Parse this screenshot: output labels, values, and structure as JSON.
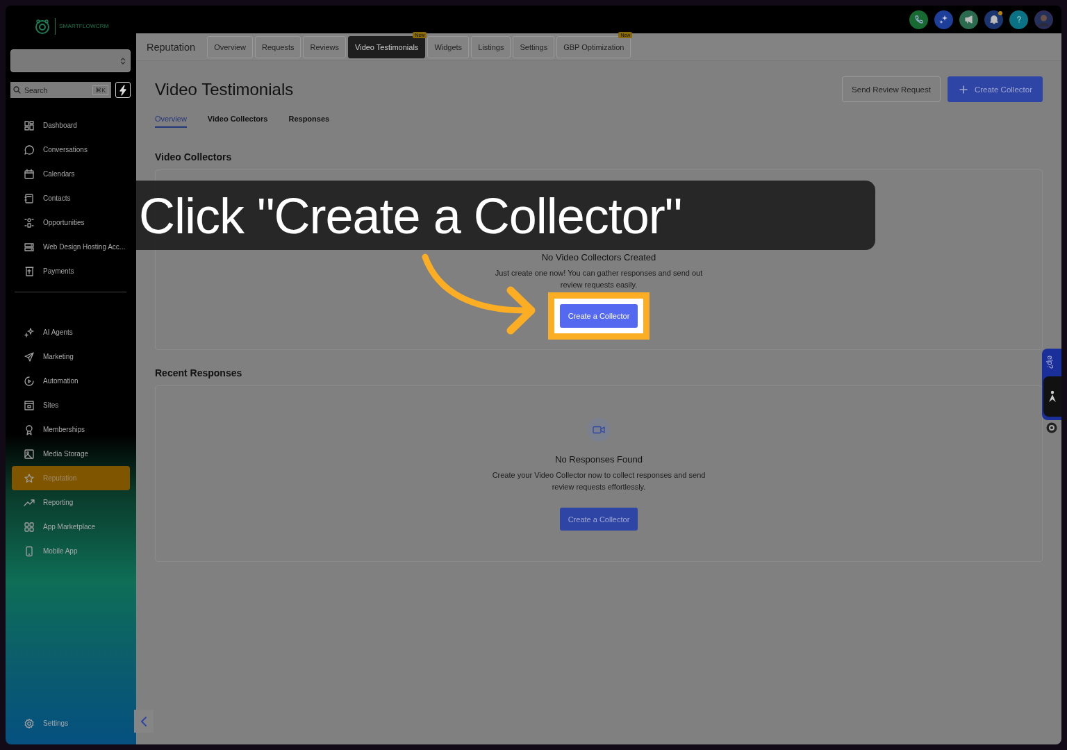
{
  "sidebar": {
    "logo": "SMARTFLOWCRM",
    "search": {
      "placeholder": "Search",
      "shortcut": "⌘K"
    },
    "groups": [
      [
        {
          "label": "Dashboard",
          "selected": false
        },
        {
          "label": "Conversations",
          "selected": false
        },
        {
          "label": "Calendars",
          "selected": false
        },
        {
          "label": "Contacts",
          "selected": false
        },
        {
          "label": "Opportunities",
          "selected": false
        },
        {
          "label": "Web Design Hosting Acc...",
          "selected": false
        },
        {
          "label": "Payments",
          "selected": false
        }
      ],
      [
        {
          "label": "AI Agents",
          "selected": false
        },
        {
          "label": "Marketing",
          "selected": false
        },
        {
          "label": "Automation",
          "selected": false
        },
        {
          "label": "Sites",
          "selected": false
        },
        {
          "label": "Memberships",
          "selected": false
        },
        {
          "label": "Media Storage",
          "selected": false
        },
        {
          "label": "Reputation",
          "selected": true
        },
        {
          "label": "Reporting",
          "selected": false
        },
        {
          "label": "App Marketplace",
          "selected": false
        },
        {
          "label": "Mobile App",
          "selected": false
        }
      ]
    ],
    "settings": "Settings"
  },
  "top_bar": {
    "notification_dot": true
  },
  "header": {
    "section": "Reputation",
    "tabs": [
      {
        "label": "Overview",
        "selected": false
      },
      {
        "label": "Requests",
        "selected": false
      },
      {
        "label": "Reviews",
        "selected": false
      },
      {
        "label": "Video Testimonials",
        "selected": true,
        "badge": "New"
      },
      {
        "label": "Widgets",
        "selected": false
      },
      {
        "label": "Listings",
        "selected": false
      },
      {
        "label": "Settings",
        "selected": false
      },
      {
        "label": "GBP Optimization",
        "selected": false,
        "badge": "New"
      }
    ]
  },
  "page": {
    "title": "Video Testimonials",
    "actions": [
      {
        "label": "Send Review Request",
        "kind": "secondary"
      },
      {
        "label": "Create Collector",
        "kind": "primary"
      }
    ],
    "subtabs": [
      {
        "label": "Overview",
        "selected": true
      },
      {
        "label": "Video Collectors",
        "selected": false
      },
      {
        "label": "Responses",
        "selected": false
      }
    ],
    "sections": [
      {
        "heading": "Video Collectors",
        "empty_title": "No Video Collectors Created",
        "empty_text": "Just create one now! You can gather responses and send out review requests easily.",
        "button": "Create a Collector",
        "highlighted": true
      },
      {
        "heading": "Recent Responses",
        "empty_title": "No Responses Found",
        "empty_text": "Create your Video Collector now to collect responses and send review requests effortlessly.",
        "button": "Create a Collector",
        "highlighted": false
      }
    ]
  },
  "callout": {
    "text": "Click \"Create a Collector\""
  },
  "help_tab": {
    "label": "elp?"
  }
}
